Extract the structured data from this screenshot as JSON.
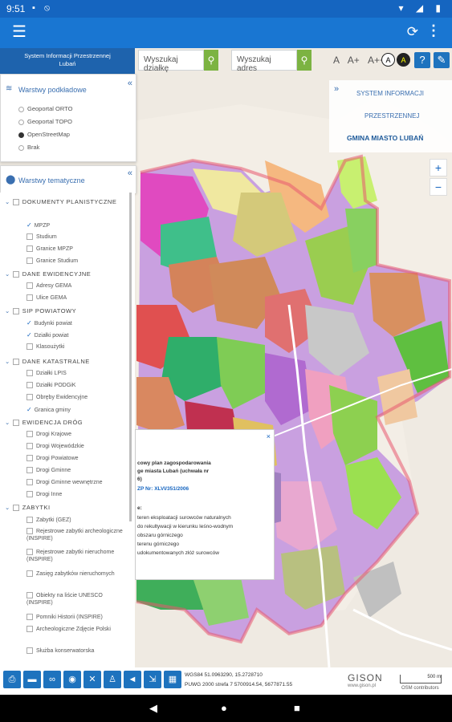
{
  "status": {
    "time": "9:51",
    "left_icons": "▪ ⦸",
    "right_icons": "▾ ◢ ▮"
  },
  "app": {
    "brand_line1": "System Informacji Przestrzennej",
    "brand_line2": "Lubań"
  },
  "search": {
    "plot_placeholder": "Wyszukaj działkę",
    "address_placeholder": "Wyszukaj adres"
  },
  "font_controls": {
    "small": "A",
    "medium": "A+",
    "large": "A++",
    "contrast_a": "A",
    "contrast_b": "A"
  },
  "base_layers": {
    "title": "Warstwy podkładowe",
    "options": [
      {
        "label": "Geoportal ORTO",
        "selected": false
      },
      {
        "label": "Geoportal TOPO",
        "selected": false
      },
      {
        "label": "OpenStreetMap",
        "selected": true
      },
      {
        "label": "Brak",
        "selected": false
      }
    ]
  },
  "thematic": {
    "title": "Warstwy tematyczne",
    "groups": [
      {
        "name": "DOKUMENTY PLANISTYCZNE",
        "items": [
          {
            "label": "MPZP",
            "checked": true
          },
          {
            "label": "Studium",
            "checked": false
          },
          {
            "label": "Granice MPZP",
            "checked": false
          },
          {
            "label": "Granice Studium",
            "checked": false
          }
        ]
      },
      {
        "name": "DANE EWIDENCYJNE",
        "items": [
          {
            "label": "Adresy GEMA",
            "checked": false
          },
          {
            "label": "Ulice GEMA",
            "checked": false
          }
        ]
      },
      {
        "name": "SIP POWIATOWY",
        "items": [
          {
            "label": "Budynki powiat",
            "checked": true
          },
          {
            "label": "Działki powiat",
            "checked": true
          },
          {
            "label": "Klasoużytki",
            "checked": false
          }
        ]
      },
      {
        "name": "DANE KATASTRALNE",
        "items": [
          {
            "label": "Działki LPIS",
            "checked": false
          },
          {
            "label": "Działki PODGiK",
            "checked": false
          },
          {
            "label": "Obręby Ewidencyjne",
            "checked": false
          },
          {
            "label": "Granica gminy",
            "checked": true
          }
        ]
      },
      {
        "name": "EWIDENCJA DRÓG",
        "items": [
          {
            "label": "Drogi Krajowe",
            "checked": false
          },
          {
            "label": "Drogi Wojewódzkie",
            "checked": false
          },
          {
            "label": "Drogi Powiatowe",
            "checked": false
          },
          {
            "label": "Drogi Gminne",
            "checked": false
          },
          {
            "label": "Drogi Gminne wewnętrzne",
            "checked": false
          },
          {
            "label": "Drogi Inne",
            "checked": false
          }
        ]
      },
      {
        "name": "ZABYTKI",
        "items": [
          {
            "label": "Zabytki (GEZ)",
            "checked": false
          },
          {
            "label": "Rejestrowe zabytki archeologiczne (INSPIRE)",
            "checked": false
          },
          {
            "label": "Rejestrowe zabytki nieruchome (INSPIRE)",
            "checked": false
          },
          {
            "label": "Zasięg zabytków nieruchomych",
            "checked": false
          },
          {
            "label": "Obiekty na liście UNESCO (INSPIRE)",
            "checked": false
          },
          {
            "label": "Pomniki Historii (INSPIRE)",
            "checked": false
          },
          {
            "label": "Archeologiczne Zdjęcie Polski",
            "checked": false
          },
          {
            "label": "Służba konserwatorska",
            "checked": false
          }
        ]
      }
    ]
  },
  "popup": {
    "line1": "cowy plan zagospodarowania",
    "line2": "ge miasta Lubań (uchwała nr",
    "line3": "6)",
    "link": "ZP Nr: XLVI/351/2006",
    "line5": "e:",
    "desc": [
      "teren eksploatacji surowców naturalnych",
      "do rekultywacji w kierunku leśno-wodnym",
      "obszaru górniczego",
      "terenu górniczego",
      "udokumentowanych złóż surowców"
    ]
  },
  "info_panel": {
    "line1": "SYSTEM INFORMACJI",
    "line2": "PRZESTRZENNEJ",
    "line3": "GMINA MIASTO LUBAŃ"
  },
  "zoom": {
    "plus": "+",
    "minus": "−"
  },
  "coords": {
    "line1": "WGS84 51.0963290, 15.2728710",
    "line2": "PUWG 2000 strefa 7 5700914.54, 5677871.55"
  },
  "branding": {
    "gison": "GISON",
    "gison_url": "www.gison.pl",
    "scale": "500 m",
    "osm": "OSM contributors"
  },
  "colors": {
    "primary": "#1976d2",
    "accent_green": "#7cb342",
    "tool_blue": "#1e73be"
  }
}
